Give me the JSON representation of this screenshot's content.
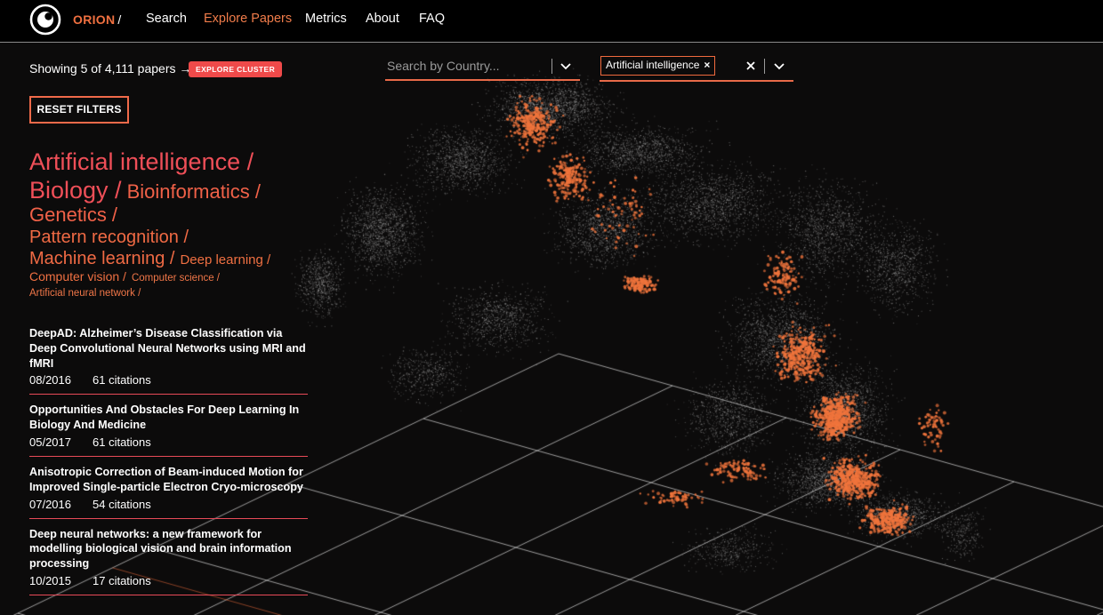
{
  "nav": {
    "brand": "ORION",
    "slash": "/",
    "items": [
      "Search",
      "Explore Papers",
      "Metrics",
      "About",
      "FAQ"
    ],
    "active_index": 1
  },
  "results": {
    "showing_text": "Showing 5 of 4,111 papers →",
    "explore_cluster_label": "EXPLORE CLUSTER",
    "reset_filters_label": "RESET FILTERS"
  },
  "search": {
    "country_placeholder": "Search by Country...",
    "filter_chip_label": "Artificial intelligence",
    "chip_remove_glyph": "×"
  },
  "tags": [
    [
      {
        "text": "Artificial intelligence /",
        "color": "#ef4f58",
        "size": 27
      }
    ],
    [
      {
        "text": "Biology /",
        "color": "#ef4f58",
        "size": 27
      },
      {
        "text": "Bioinformatics /",
        "color": "#f06148",
        "size": 22
      }
    ],
    [
      {
        "text": "Genetics /",
        "color": "#f06148",
        "size": 22
      }
    ],
    [
      {
        "text": "Pattern recognition /",
        "color": "#f06a44",
        "size": 20
      }
    ],
    [
      {
        "text": "Machine learning /",
        "color": "#f06a44",
        "size": 20
      },
      {
        "text": "Deep learning /",
        "color": "#f07042",
        "size": 15
      }
    ],
    [
      {
        "text": "Computer vision /",
        "color": "#f07042",
        "size": 14
      },
      {
        "text": "Computer science /",
        "color": "#f07648",
        "size": 11.5
      }
    ],
    [
      {
        "text": "Artificial neural network /",
        "color": "#f07648",
        "size": 11.5
      }
    ]
  ],
  "papers": [
    {
      "title": "DeepAD: Alzheimer’s Disease Classification via Deep Convolutional Neural Networks using MRI and fMRI",
      "date": "08/2016",
      "citations": "61 citations"
    },
    {
      "title": "Opportunities And Obstacles For Deep Learning In Biology And Medicine",
      "date": "05/2017",
      "citations": "61 citations"
    },
    {
      "title": "Anisotropic Correction of Beam-induced Motion for Improved Single-particle Electron Cryo-microscopy",
      "date": "07/2016",
      "citations": "54 citations"
    },
    {
      "title": "Deep neural networks: a new framework for modelling biological vision and brain information processing",
      "date": "10/2015",
      "citations": "17 citations"
    }
  ],
  "colors": {
    "accent": "#f07c4a",
    "badge": "#ef4a4a",
    "tag_red": "#ef4f58",
    "highlight_point": "#f0743c",
    "background_point": "#bdbdbd",
    "grid": "#cfcfcf"
  },
  "icons": {
    "logo": "orion-ring-logo",
    "dropdown": "chevron-down-icon",
    "clear": "close-icon"
  }
}
